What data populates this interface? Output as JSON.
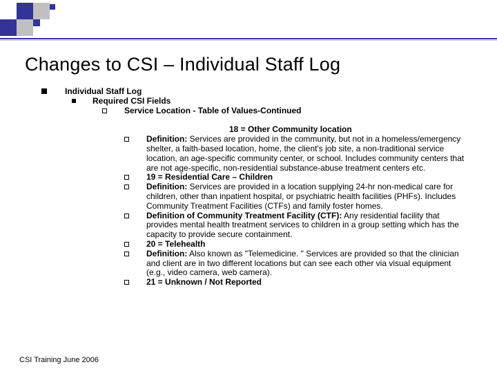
{
  "deco": {
    "dark": "#333399",
    "grey": "#c0c0c0"
  },
  "title": "Changes to CSI – Individual Staff Log",
  "lvl1": "Individual Staff Log",
  "lvl2": "Required CSI Fields",
  "lvl3": "Service Location - Table of Values-Continued",
  "code18_label": "18 = Other Community location",
  "items": [
    {
      "html": "<span class=\"bold\">Definition:</span> Services are provided in the community, but not in a homeless/emergency shelter, a faith-based location, home, the client's job site, a non-traditional service location, an age-specific community center, or school. Includes community centers that are not age-specific, non-residential substance-abuse treatment centers etc."
    },
    {
      "html": "<span class=\"bold\">19 = Residential Care – Children</span>"
    },
    {
      "html": "<span class=\"bold\">Definition:</span> Services are provided in a location supplying 24-hr non-medical care for children, other than inpatient hospital, or psychiatric health facilities (PHFs). Includes Community Treatment Facilities (CTFs) and family foster homes."
    },
    {
      "html": "<span class=\"bold\">Definition of Community Treatment Facility (CTF):</span> Any residential facility that provides mental health treatment services to children in a group setting which has the capacity to provide secure containment."
    },
    {
      "html": "<span class=\"bold\">20 = Telehealth</span>"
    },
    {
      "html": "<span class=\"bold\">Definition:</span> Also known as \"Telemedicine. \"  Services are provided so that the clinician and client are in two different locations but can see each other via visual equipment (e.g., video camera, web camera)."
    },
    {
      "html": "<span class=\"bold\">21 = Unknown / Not Reported</span>"
    }
  ],
  "footer": "CSI Training June 2006"
}
